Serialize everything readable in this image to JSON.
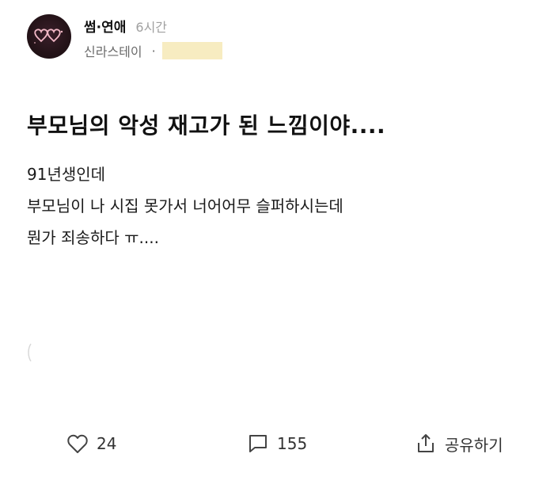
{
  "post": {
    "board": "썸·연애",
    "time": "6시간",
    "school": "신라스테이",
    "separator": "·",
    "title": "부모님의 악성 재고가 된 느낌이야....",
    "body_lines": [
      "91년생인데",
      "부모님이 나 시집 못가서 너어어무 슬퍼하시는데",
      "뭔가 죄송하다 ㅠ...."
    ]
  },
  "actions": {
    "like_count": "24",
    "comment_count": "155",
    "share_label": "공유하기"
  },
  "icons": {
    "avatar": "neon-hearts-avatar",
    "like": "heart-icon",
    "comment": "comment-bubble-icon",
    "share": "share-icon"
  },
  "colors": {
    "redacted": "#f7ecc1",
    "muted_text": "#a0a0a0",
    "avatar_neon": "#f2b8c6"
  }
}
